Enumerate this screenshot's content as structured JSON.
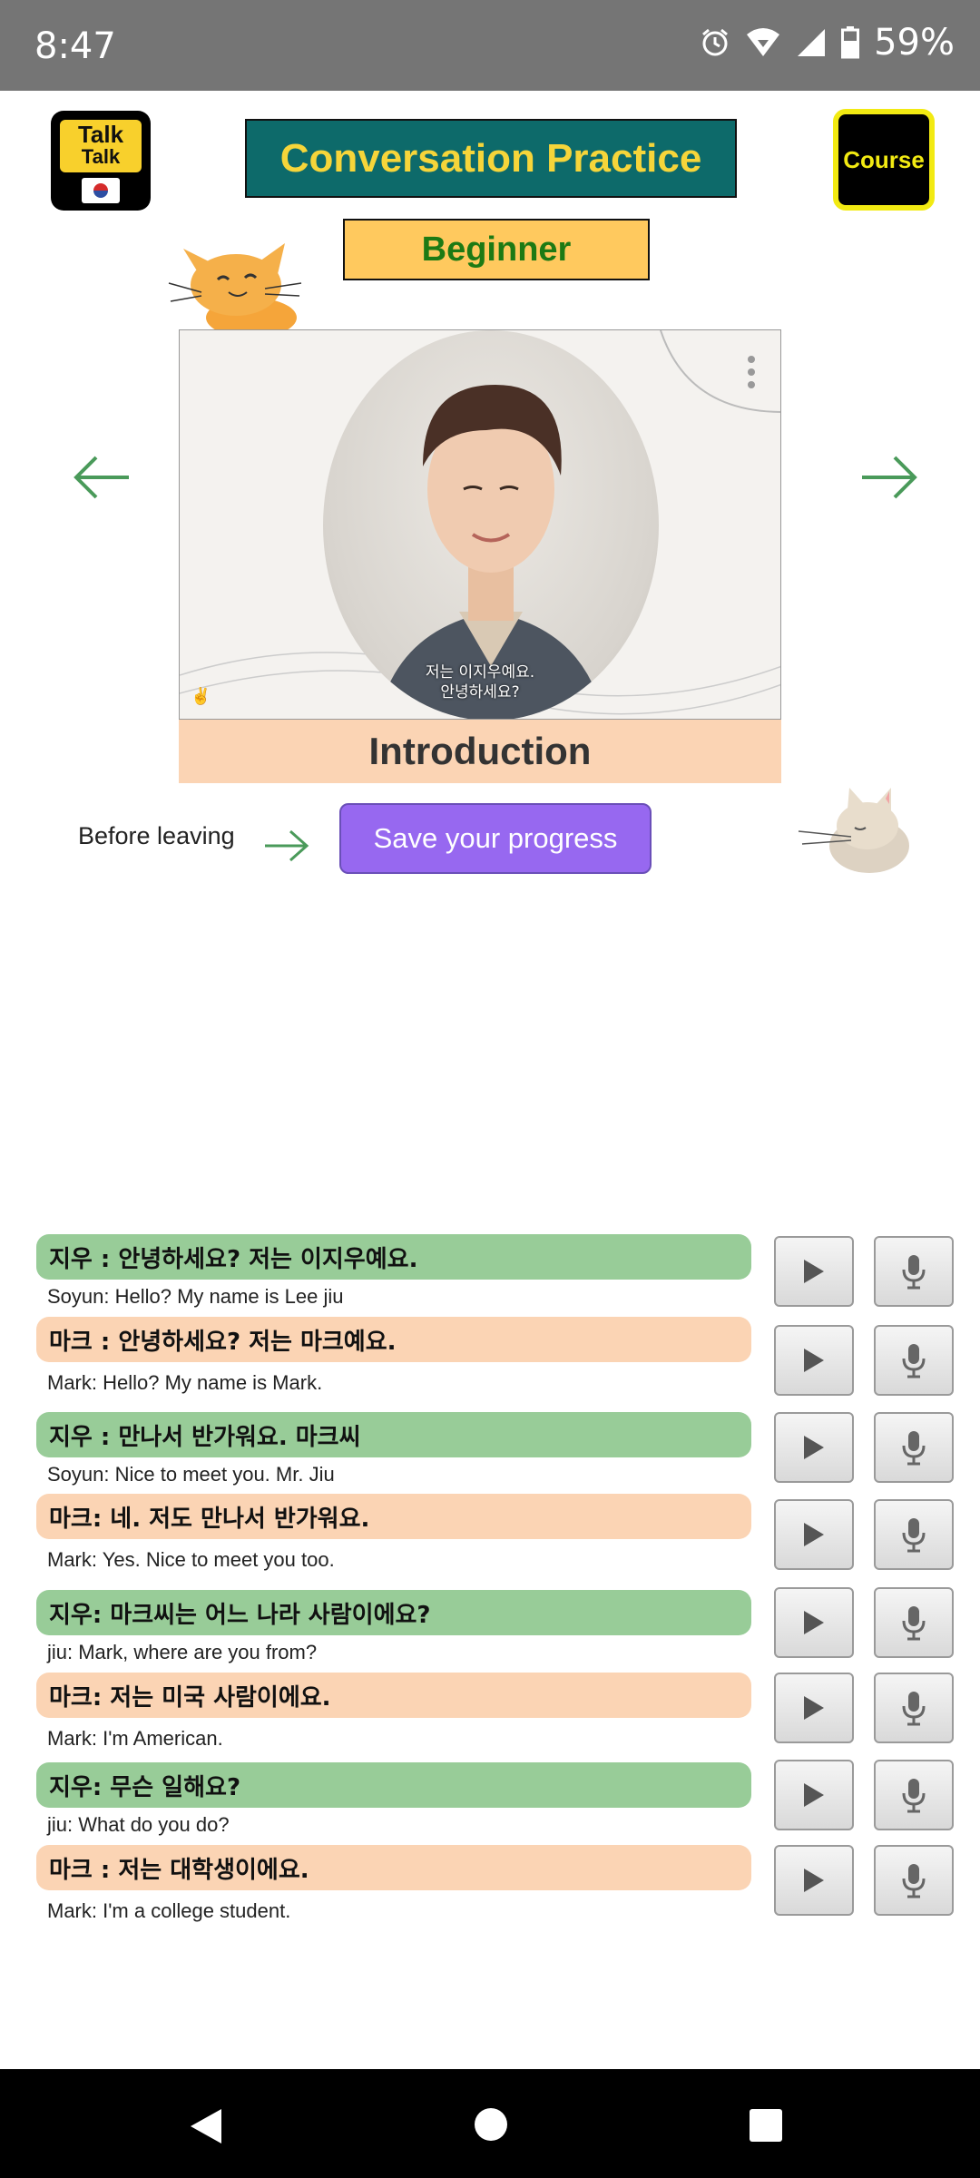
{
  "status_bar": {
    "time": "8:47",
    "battery": "59%"
  },
  "logo": {
    "line1": "Talk",
    "line2": "Talk"
  },
  "header": {
    "title": "Conversation Practice",
    "course_label": "Course",
    "level": "Beginner"
  },
  "video": {
    "caption_line1": "저는 이지우예요.",
    "caption_line2": "안녕하세요?",
    "lesson_title": "Introduction"
  },
  "save_row": {
    "before_text": "Before leaving",
    "button_label": "Save your progress"
  },
  "dialogue": [
    {
      "korean": "지우 : 안녕하세요? 저는 이지우예요.",
      "english": "Soyun: Hello? My name is Lee jiu",
      "color": "green"
    },
    {
      "korean": "마크 : 안녕하세요? 저는 마크예요.",
      "english": "Mark: Hello? My name is Mark.",
      "color": "peach"
    },
    {
      "korean": "지우 : 만나서 반가워요. 마크씨",
      "english": "Soyun: Nice to meet you. Mr. Jiu",
      "color": "green"
    },
    {
      "korean": "마크: 네. 저도 만나서 반가워요.",
      "english": "Mark: Yes. Nice to meet you too.",
      "color": "peach"
    },
    {
      "korean": "지우: 마크씨는 어느 나라 사람이에요?",
      "english": "jiu: Mark, where are you from?",
      "color": "green"
    },
    {
      "korean": "마크: 저는 미국 사람이에요.",
      "english": "Mark: I'm American.",
      "color": "peach"
    },
    {
      "korean": "지우: 무슨 일해요?",
      "english": "jiu: What do you do?",
      "color": "green"
    },
    {
      "korean": "마크 : 저는 대학생이에요.",
      "english": "Mark: I'm a college student.",
      "color": "peach"
    }
  ],
  "colors": {
    "title_bg": "#0d6a6a",
    "title_text": "#f6d53a",
    "level_bg": "#ffc95e",
    "level_text": "#1d7a14",
    "save_bg": "#9768f0",
    "green_bubble": "#98cc98",
    "peach_bubble": "#fbd4b4",
    "arrow": "#4a9a5a"
  },
  "icons": [
    "alarm-icon",
    "wifi-icon",
    "signal-icon",
    "battery-icon",
    "arrow-left-icon",
    "arrow-right-icon",
    "play-icon",
    "mic-icon",
    "back-icon",
    "home-icon",
    "recents-icon"
  ]
}
